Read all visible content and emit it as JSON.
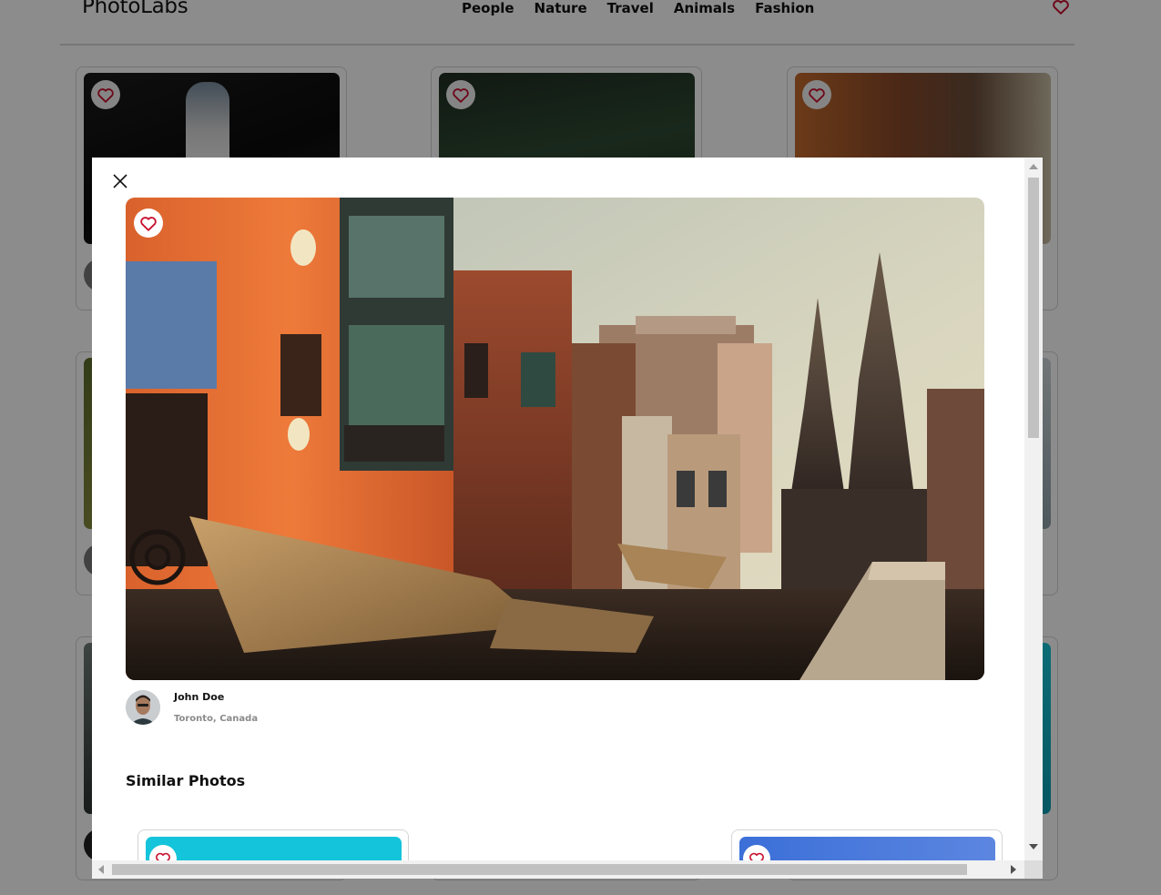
{
  "app": {
    "title": "PhotoLabs"
  },
  "nav": {
    "topics": [
      "People",
      "Nature",
      "Travel",
      "Animals",
      "Fashion"
    ],
    "heart_icon": "heart-outline-icon"
  },
  "modal": {
    "close_icon": "close-icon",
    "favorite_icon": "heart-outline-icon",
    "photo_user": {
      "name": "John Doe",
      "location": "Toronto, Canada"
    },
    "similar_heading": "Similar Photos"
  },
  "colors": {
    "heart": "#c8102e",
    "overlay": "rgba(0,0,0,0.45)",
    "modal_bg": "#ffffff"
  }
}
